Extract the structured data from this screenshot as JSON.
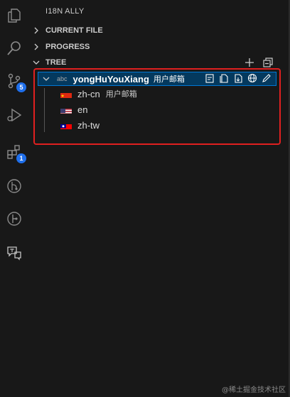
{
  "activity_bar": {
    "items": [
      {
        "name": "explorer-icon"
      },
      {
        "name": "search-icon"
      },
      {
        "name": "source-control-icon",
        "badge": "5"
      },
      {
        "name": "run-debug-icon"
      },
      {
        "name": "extensions-icon",
        "badge": "1"
      },
      {
        "name": "git-graph-icon"
      },
      {
        "name": "git-lens-icon"
      },
      {
        "name": "i18n-ally-icon"
      }
    ]
  },
  "sidebar": {
    "title": "I18N ALLY",
    "sections": {
      "current_file": "CURRENT FILE",
      "progress": "PROGRESS",
      "tree": "TREE"
    },
    "tree": {
      "root": {
        "type_label": "abc",
        "key": "yongHuYouXiang",
        "value": "用户邮箱"
      },
      "locales": [
        {
          "code": "zh-cn",
          "value": "用户邮箱",
          "flag": "china"
        },
        {
          "code": "en",
          "value": "",
          "flag": "usa"
        },
        {
          "code": "zh-tw",
          "value": "",
          "flag": "taiwan"
        }
      ]
    }
  },
  "watermark": "@稀土掘金技术社区",
  "colors": {
    "highlight_border": "#e02020",
    "selection_bg": "#04395e",
    "badge": "#1f6feb"
  }
}
